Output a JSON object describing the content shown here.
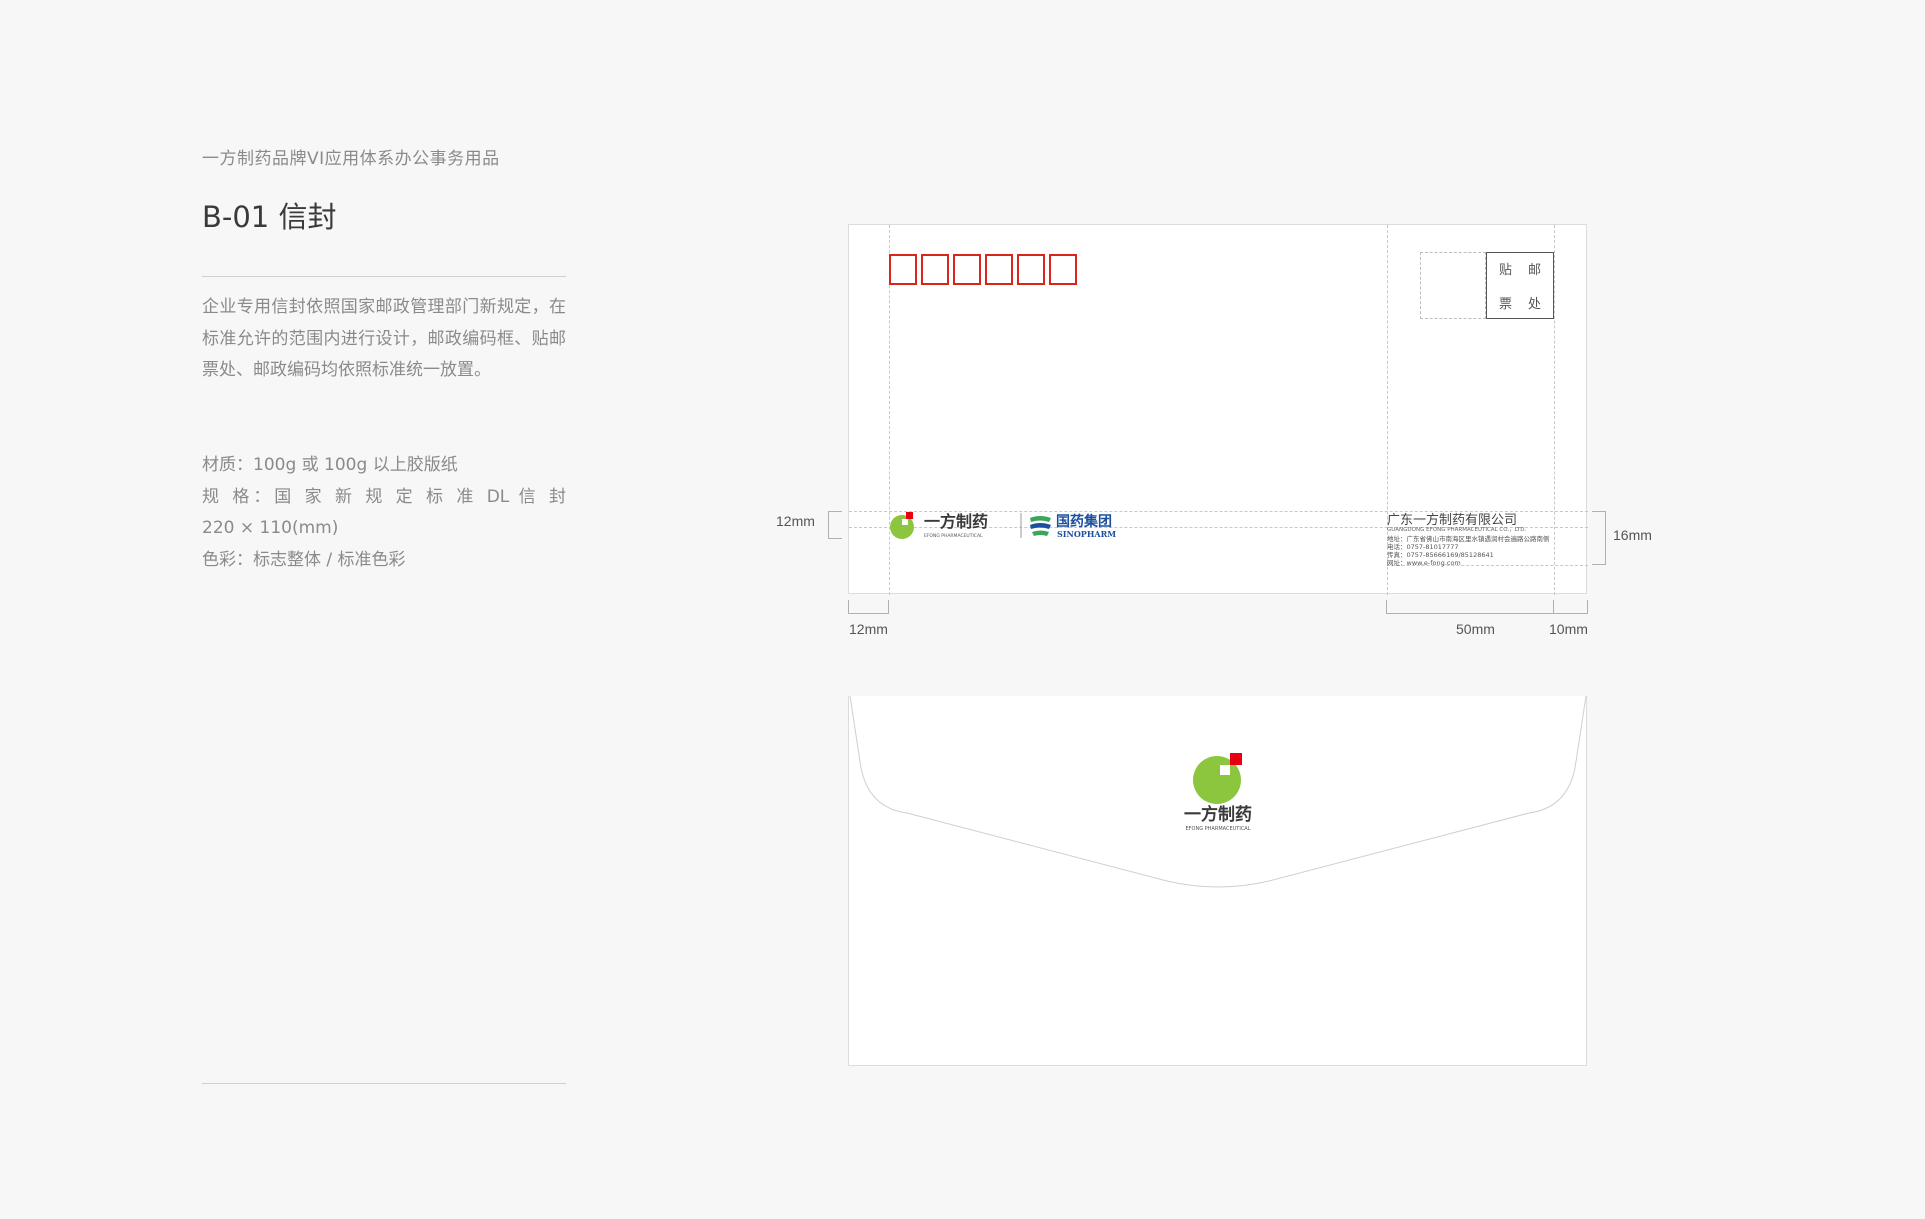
{
  "header": {
    "subtitle": "一方制药品牌VI应用体系办公事务用品",
    "title": "B-01 信封"
  },
  "description": "企业专用信封依照国家邮政管理部门新规定，在标准允许的范围内进行设计，邮政编码框、贴邮票处、邮政编码均依照标准统一放置。",
  "specs": {
    "material": "材质：100g 或 100g 以上胶版纸",
    "size_line1": "规 格：国 家 新 规 定 标 准 DL 信 封",
    "size_line2": "220 × 110(mm)",
    "color": "色彩：标志整体 / 标准色彩"
  },
  "envelope_front": {
    "postcode_boxes": 6,
    "stamp_label": [
      "贴",
      "邮",
      "票",
      "处"
    ],
    "logo_cn": "一方制药",
    "logo_en": "EFONG PHARMACEUTICAL",
    "partner_cn": "国药集团",
    "partner_en": "SINOPHARM",
    "company_name": "广东一方制药有限公司",
    "company_en": "GUANGDONG EFONG PHARMACEUTICAL CO.，LTD.",
    "address_lines": [
      "地址：广东省佛山市南海区里水镇遇润村会遍路公路南侧",
      "电话：0757-81017777",
      "传真：0757-85666169/85128641",
      "网址：www.e-fong.com"
    ],
    "dimensions": {
      "left_height": "12mm",
      "right_height": "16mm",
      "left_margin": "12mm",
      "address_width": "50mm",
      "right_margin": "10mm"
    }
  },
  "envelope_back": {
    "logo_cn": "一方制药",
    "logo_en": "EFONG PHARMACEUTICAL"
  },
  "colors": {
    "logo_green": "#8cc63f",
    "logo_red": "#e60012",
    "postcode_red": "#d9261c",
    "sinopharm_blue": "#1d4fa0",
    "sinopharm_green": "#3aa55d"
  }
}
